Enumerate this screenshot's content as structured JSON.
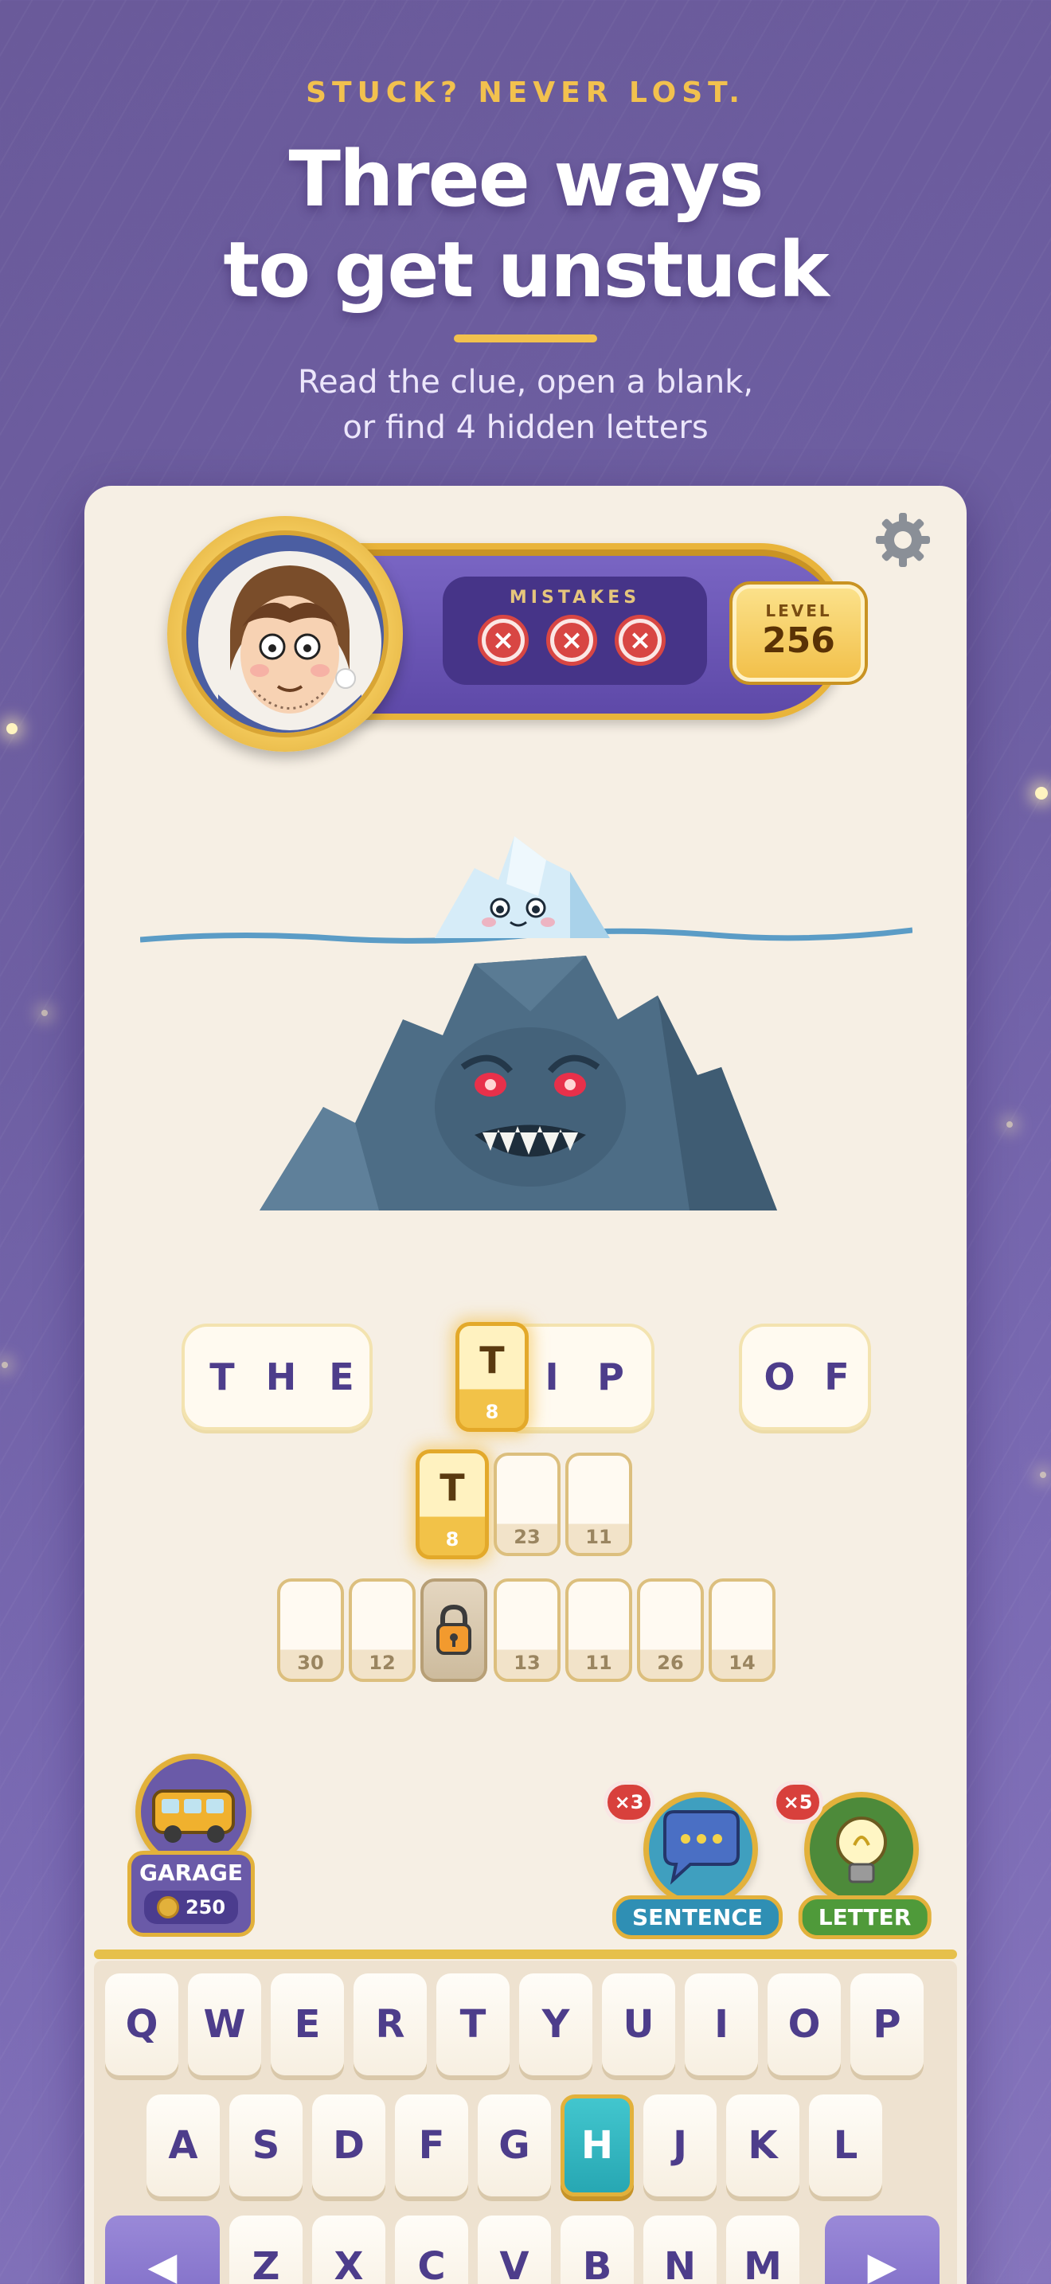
{
  "header": {
    "eyebrow": "STUCK? NEVER LOST.",
    "headline_line1": "Three ways",
    "headline_line2": "to get unstuck",
    "subtitle_line1": "Read the clue, open a blank,",
    "subtitle_line2": "or find 4 hidden letters"
  },
  "colors": {
    "background": "#6e5fa3",
    "accent_gold": "#f2c14e",
    "card": "#f6efe4",
    "hud_purple": "#5e49a8",
    "mistake_red": "#d84643",
    "active_key": "#2fb3bd"
  },
  "hud": {
    "avatar_icon": "player-avatar",
    "mistakes_label": "MISTAKES",
    "mistakes": [
      "x",
      "x",
      "x"
    ],
    "level_label": "LEVEL",
    "level_value": "256",
    "settings_icon": "gear-icon"
  },
  "illustration": {
    "subject": "iceberg-icon"
  },
  "puzzle": {
    "row1": {
      "word1": [
        "T",
        "H",
        "E"
      ],
      "word2": {
        "revealed": {
          "letter": "T",
          "number": "8"
        },
        "letters": [
          "I",
          "P"
        ]
      },
      "word3": [
        "O",
        "F"
      ]
    },
    "row2": {
      "revealed": {
        "letter": "T",
        "number": "8"
      },
      "blanks": [
        "23",
        "11"
      ]
    },
    "row3": {
      "blanks_before": [
        "30",
        "12"
      ],
      "locked_icon": "lock-icon",
      "blanks_after": [
        "13",
        "11",
        "26",
        "14"
      ]
    }
  },
  "powerups": {
    "garage": {
      "label": "GARAGE",
      "coins": "250",
      "icon": "bus-icon"
    },
    "sentence": {
      "label": "SENTENCE",
      "count": "×3",
      "icon": "speech-bubble-icon"
    },
    "letter": {
      "label": "LETTER",
      "count": "×5",
      "icon": "lightbulb-icon"
    }
  },
  "keyboard": {
    "row1": [
      "Q",
      "W",
      "E",
      "R",
      "T",
      "Y",
      "U",
      "I",
      "O",
      "P"
    ],
    "row2": [
      "A",
      "S",
      "D",
      "F",
      "G",
      "H",
      "J",
      "K",
      "L"
    ],
    "row3": [
      "Z",
      "X",
      "C",
      "V",
      "B",
      "N",
      "M"
    ],
    "active_key": "H",
    "left_action_icon": "left-arrow-icon",
    "right_action_icon": "right-arrow-icon"
  }
}
